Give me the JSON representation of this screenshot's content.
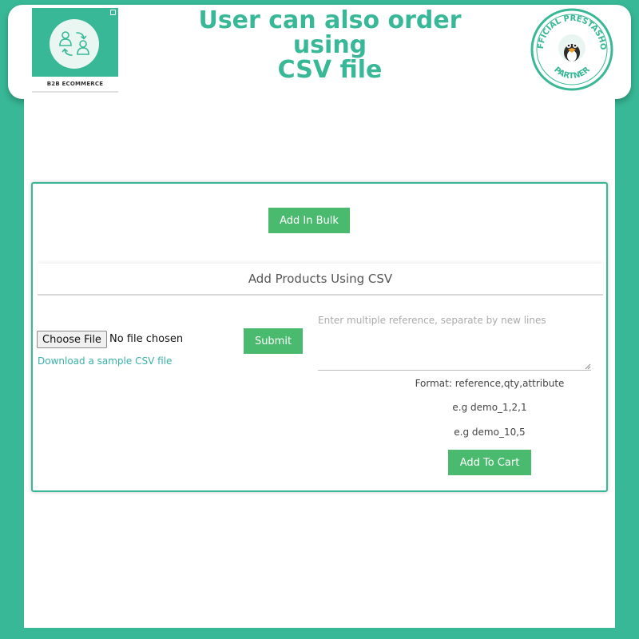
{
  "header": {
    "title_lines": [
      "User can also order",
      "using",
      "CSV file"
    ],
    "logo_caption": "B2B ECOMMERCE",
    "seal_top_text": "OFFICIAL PRESTASHOP",
    "seal_bottom_text": "PARTNER"
  },
  "panel": {
    "bulk_button_label": "Add In Bulk",
    "section_title": "Add Products Using CSV",
    "file_button_label": "Choose File",
    "file_status": "No file chosen",
    "sample_link": "Download a sample CSV file",
    "submit_label": "Submit",
    "textarea_placeholder": "Enter multiple reference, separate by new lines",
    "format_hint": "Format: reference,qty,attribute",
    "example_1": "e.g demo_1,2,1",
    "example_2": "e.g demo_10,5",
    "add_to_cart_label": "Add To Cart"
  },
  "colors": {
    "brand_green": "#38b896",
    "button_green": "#4aba6e",
    "link_teal": "#3ab0a8"
  }
}
